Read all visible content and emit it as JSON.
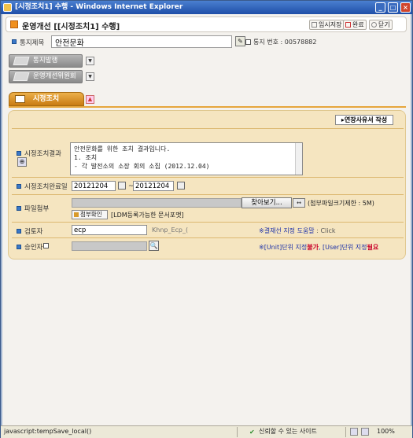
{
  "window": {
    "title": "[시정조치1] 수행 - Windows Internet Explorer"
  },
  "header": {
    "title": "운영개선 [[시정조치1] 수행]",
    "buttons": {
      "save": "임시저장",
      "done": "완료",
      "close": "닫기"
    }
  },
  "subject": {
    "label": "통지제목",
    "value": "안전문화",
    "docno_label": "통지 번호 : 00578882"
  },
  "side_buttons": {
    "notice": "통지발행",
    "committee": "운영개선위원회"
  },
  "section": {
    "tab": "시정조치",
    "ext_button": "연장사유서 작성"
  },
  "form": {
    "result": {
      "label": "시정조치결과",
      "lines": [
        "안전문화를 위한 조치 결과입니다.",
        "1. 조치",
        "- 각 발전소의 소장 회의 소집 (2012.12.04)"
      ]
    },
    "complete_date": {
      "label": "시정조치완료일",
      "from": "20121204",
      "sep": "~",
      "to": "20121204"
    },
    "attachment": {
      "label": "파일첨부",
      "browse": "찾아보기...",
      "note": "(첨부파일크기제한 : 5M)",
      "check_button": "첨부확인",
      "check_note": "[LDM등록가능한 문서포맷]"
    },
    "reviewer": {
      "label": "검토자",
      "value": "ecp",
      "hint": "Khnp_Ecp_(",
      "help_prefix": "※결재선 지정 도움말",
      "help_rest": " : Click"
    },
    "approver": {
      "label": "승인자",
      "unit_text_1": "※[Unit]단위 지정",
      "unit_no": "불가",
      "unit_text_2": ", [User]단위 지정",
      "unit_req": "필요"
    }
  },
  "statusbar": {
    "text": "javascript:tempSave_local()",
    "trust": "신뢰할 수 있는 사이트",
    "zoom": "100%"
  },
  "colors": {
    "accent": "#e6a63c",
    "panel": "#f5e5c0",
    "link": "#1a2fa8",
    "warn": "#c8002a"
  }
}
